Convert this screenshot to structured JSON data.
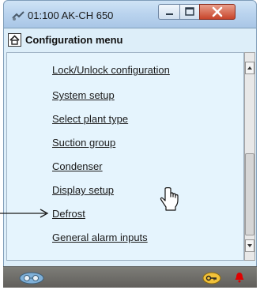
{
  "window": {
    "title": "01:100 AK-CH 650"
  },
  "header": {
    "title": "Configuration menu"
  },
  "menu": {
    "items": [
      {
        "label": "Lock/Unlock configuration"
      },
      {
        "label": "System setup"
      },
      {
        "label": "Select plant type"
      },
      {
        "label": "Suction group"
      },
      {
        "label": "Condenser"
      },
      {
        "label": "Display setup"
      },
      {
        "label": "Defrost"
      },
      {
        "label": "General alarm inputs"
      }
    ]
  },
  "icons": {
    "title": "connection-icon",
    "home": "home-icon",
    "bottom_left": "glasses-icon",
    "bottom_key": "key-icon",
    "bottom_alarm": "bell-icon",
    "cursor": "hand-cursor-icon",
    "pointer": "arrow-icon"
  },
  "colors": {
    "client_background": "#ddeef9",
    "menu_background": "#e5f4fd",
    "close_button": "#c8452b",
    "bottom_bar": "#6a6863",
    "alarm_bell": "#e00000"
  }
}
